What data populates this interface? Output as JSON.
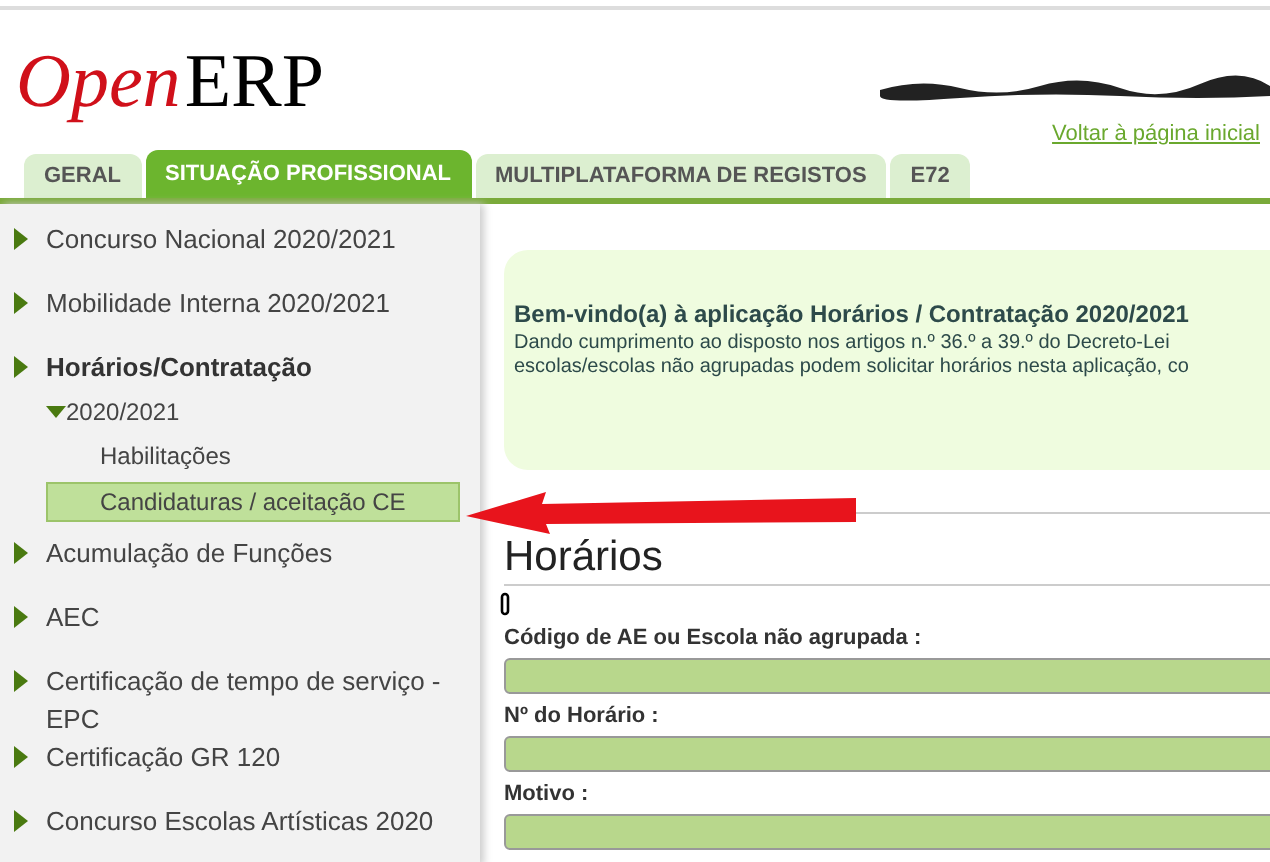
{
  "logo": {
    "part_1": "Open",
    "part_2": "ERP"
  },
  "home_link": "Voltar à página inicial",
  "tabs": [
    {
      "label": "GERAL",
      "selected": false
    },
    {
      "label": "SITUAÇÃO PROFISSIONAL",
      "selected": true
    },
    {
      "label": "MULTIPLATAFORMA DE REGISTOS",
      "selected": false
    },
    {
      "label": "E72",
      "selected": false
    }
  ],
  "sidebar": {
    "items": [
      {
        "label": "Concurso Nacional 2020/2021",
        "expanded": false
      },
      {
        "label": "Mobilidade Interna 2020/2021",
        "expanded": false
      },
      {
        "label": "Horários/Contratação",
        "expanded": true,
        "children": [
          {
            "label": "2020/2021",
            "expanded": true,
            "children": [
              {
                "label": "Habilitações",
                "selected": false
              },
              {
                "label": "Candidaturas / aceitação CE",
                "selected": true
              }
            ]
          }
        ]
      },
      {
        "label": "Acumulação de Funções",
        "expanded": false
      },
      {
        "label": "AEC",
        "expanded": false
      },
      {
        "label": "Certificação de tempo de serviço - EPC",
        "expanded": false
      },
      {
        "label": "Certificação GR 120",
        "expanded": false
      },
      {
        "label": "Concurso Escolas Artísticas 2020",
        "expanded": false
      }
    ]
  },
  "welcome": {
    "title": "Bem-vindo(a) à aplicação Horários / Contratação 2020/2021",
    "lines": [
      "Dando cumprimento ao disposto nos artigos n.º 36.º a 39.º do Decreto-Lei",
      "escolas/escolas não agrupadas podem solicitar horários nesta aplicação, co"
    ]
  },
  "form": {
    "title": "Horários",
    "fields": [
      {
        "label": "Código de AE ou Escola não agrupada :"
      },
      {
        "label": "Nº do Horário :"
      },
      {
        "label": "Motivo :"
      }
    ]
  }
}
